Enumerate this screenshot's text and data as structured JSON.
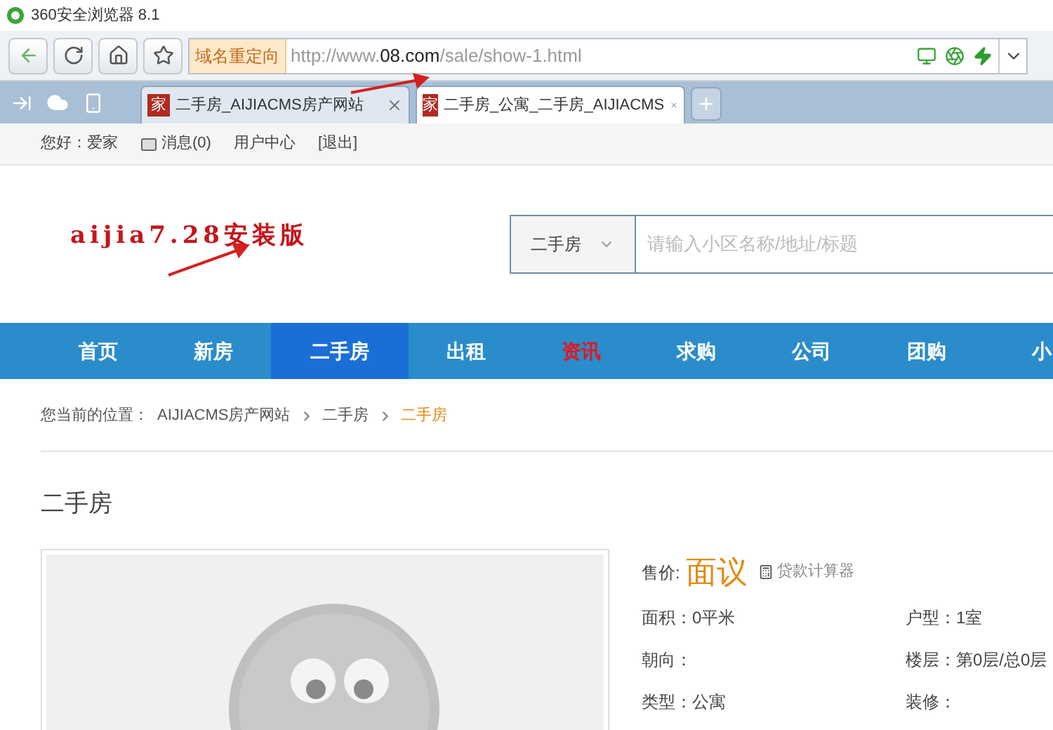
{
  "window": {
    "title": "360安全浏览器 8.1"
  },
  "toolbar": {
    "redirect_badge": "域名重定向",
    "url_prefix": "http://www.",
    "url_domain": "08.com",
    "url_path": "/sale/show-1.html"
  },
  "tabs": [
    {
      "favicon": "家",
      "label": "二手房_AIJIACMS房产网站",
      "selected": false
    },
    {
      "favicon": "家",
      "label": "二手房_公寓_二手房_AIJIACMS",
      "selected": true
    }
  ],
  "userbar": {
    "greeting": "您好：爱家",
    "messages": "消息(0)",
    "center": "用户中心",
    "logout": "[退出]"
  },
  "logo": {
    "text": "aijia7.28安装版"
  },
  "search": {
    "category": "二手房",
    "placeholder": "请输入小区名称/地址/标题"
  },
  "nav": [
    {
      "label": "首页",
      "selected": false,
      "kind": "plain"
    },
    {
      "label": "新房",
      "selected": false,
      "kind": "plain"
    },
    {
      "label": "二手房",
      "selected": true,
      "kind": "plain"
    },
    {
      "label": "出租",
      "selected": false,
      "kind": "plain"
    },
    {
      "label": "资讯",
      "selected": false,
      "kind": "hot"
    },
    {
      "label": "求购",
      "selected": false,
      "kind": "plain"
    },
    {
      "label": "公司",
      "selected": false,
      "kind": "plain"
    },
    {
      "label": "团购",
      "selected": false,
      "kind": "plain"
    },
    {
      "label": "小",
      "selected": false,
      "kind": "plain"
    }
  ],
  "breadcrumb": {
    "prefix": "您当前的位置：",
    "items": [
      "AIJIACMS房产网站",
      "二手房",
      "二手房"
    ]
  },
  "page_title": "二手房",
  "listing": {
    "price_label": "售价:",
    "price": "面议",
    "calculator": "贷款计算器",
    "details": [
      {
        "left": "面积：0平米",
        "right": "户型：1室"
      },
      {
        "left": "朝向：",
        "right": "楼层：第0层/总0层"
      },
      {
        "left": "类型：公寓",
        "right": "装修："
      }
    ]
  }
}
